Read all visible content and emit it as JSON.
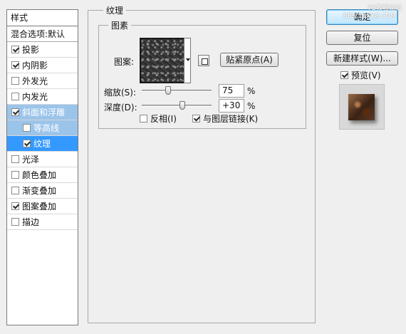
{
  "styles_panel": {
    "header": "样式",
    "blend_options": "混合选项:默认",
    "items": [
      {
        "label": "投影",
        "checked": true
      },
      {
        "label": "内阴影",
        "checked": true
      },
      {
        "label": "外发光",
        "checked": false
      },
      {
        "label": "内发光",
        "checked": false
      },
      {
        "label": "斜面和浮雕",
        "checked": true
      },
      {
        "label": "等高线",
        "checked": false
      },
      {
        "label": "纹理",
        "checked": true
      },
      {
        "label": "光泽",
        "checked": false
      },
      {
        "label": "颜色叠加",
        "checked": false
      },
      {
        "label": "渐变叠加",
        "checked": false
      },
      {
        "label": "图案叠加",
        "checked": true
      },
      {
        "label": "描边",
        "checked": false
      }
    ]
  },
  "texture": {
    "group_title": "纹理",
    "pattern_group_title": "图素",
    "pattern_label": "图案:",
    "snap_button": "贴紧原点(A)",
    "scale_label": "缩放(S):",
    "scale_value": "75",
    "scale_unit": "%",
    "depth_label": "深度(D):",
    "depth_value": "+30",
    "depth_unit": "%",
    "invert_label": "反相(I)",
    "invert_checked": false,
    "link_label": "与图层链接(K)",
    "link_checked": true
  },
  "actions": {
    "ok": "确定",
    "reset": "复位",
    "new_style": "新建样式(W)...",
    "preview_label": "预览(V)",
    "preview_checked": true
  },
  "watermark": {
    "line1": "PS教程论坛",
    "line2": "BBS.16XX8.COM"
  }
}
